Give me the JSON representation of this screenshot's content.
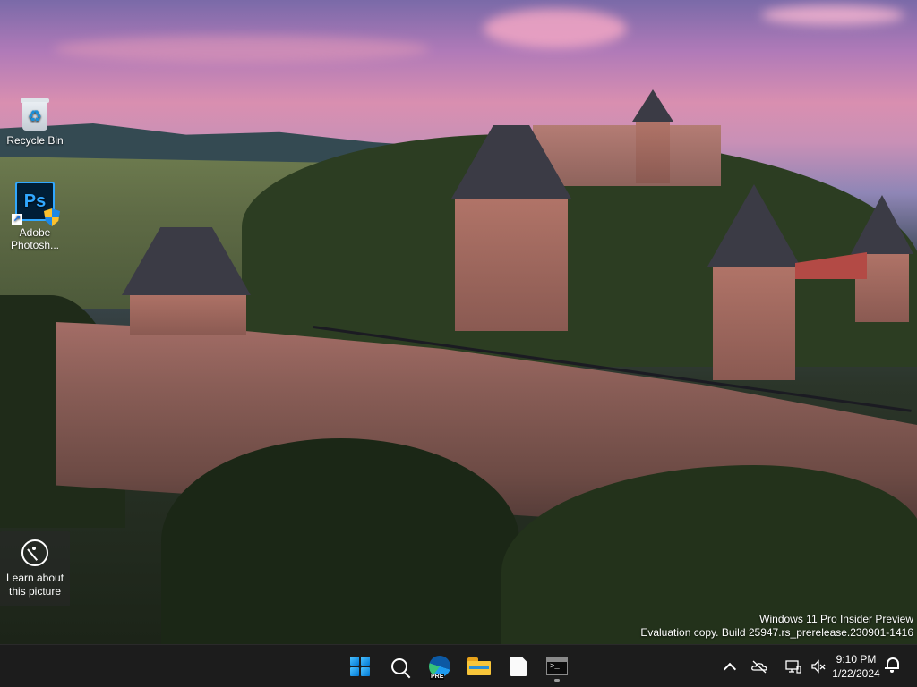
{
  "desktop": {
    "icons": [
      {
        "label": "Recycle Bin",
        "icon": "recycle-bin-icon"
      },
      {
        "label": "Adobe\nPhotosh...",
        "icon": "photoshop-icon",
        "icon_text": "Ps"
      }
    ],
    "learn_about": {
      "label": "Learn about\nthis picture",
      "icon": "camera-icon"
    },
    "watermark": {
      "line1": "Windows 11 Pro Insider Preview",
      "line2": "Evaluation copy. Build 25947.rs_prerelease.230901-1416"
    }
  },
  "taskbar": {
    "apps": [
      {
        "name": "Start",
        "icon": "windows-start-icon"
      },
      {
        "name": "Search",
        "icon": "search-icon"
      },
      {
        "name": "Microsoft Edge Preview",
        "icon": "edge-icon",
        "badge": "PRE"
      },
      {
        "name": "File Explorer",
        "icon": "folder-icon"
      },
      {
        "name": "Notepad",
        "icon": "notepad-icon"
      },
      {
        "name": "Terminal",
        "icon": "terminal-icon",
        "active": true,
        "prompt": ">_"
      }
    ],
    "tray": {
      "icons": [
        "chevron-up-icon",
        "onedrive-icon",
        "network-icon",
        "volume-muted-icon"
      ],
      "time": "9:10 PM",
      "date": "1/22/2024",
      "notification_icon": "bell-icon"
    }
  },
  "colors": {
    "taskbar_bg": "#1c1c1c",
    "windows_accent": "#0078d4",
    "photoshop_blue": "#31a8ff"
  }
}
